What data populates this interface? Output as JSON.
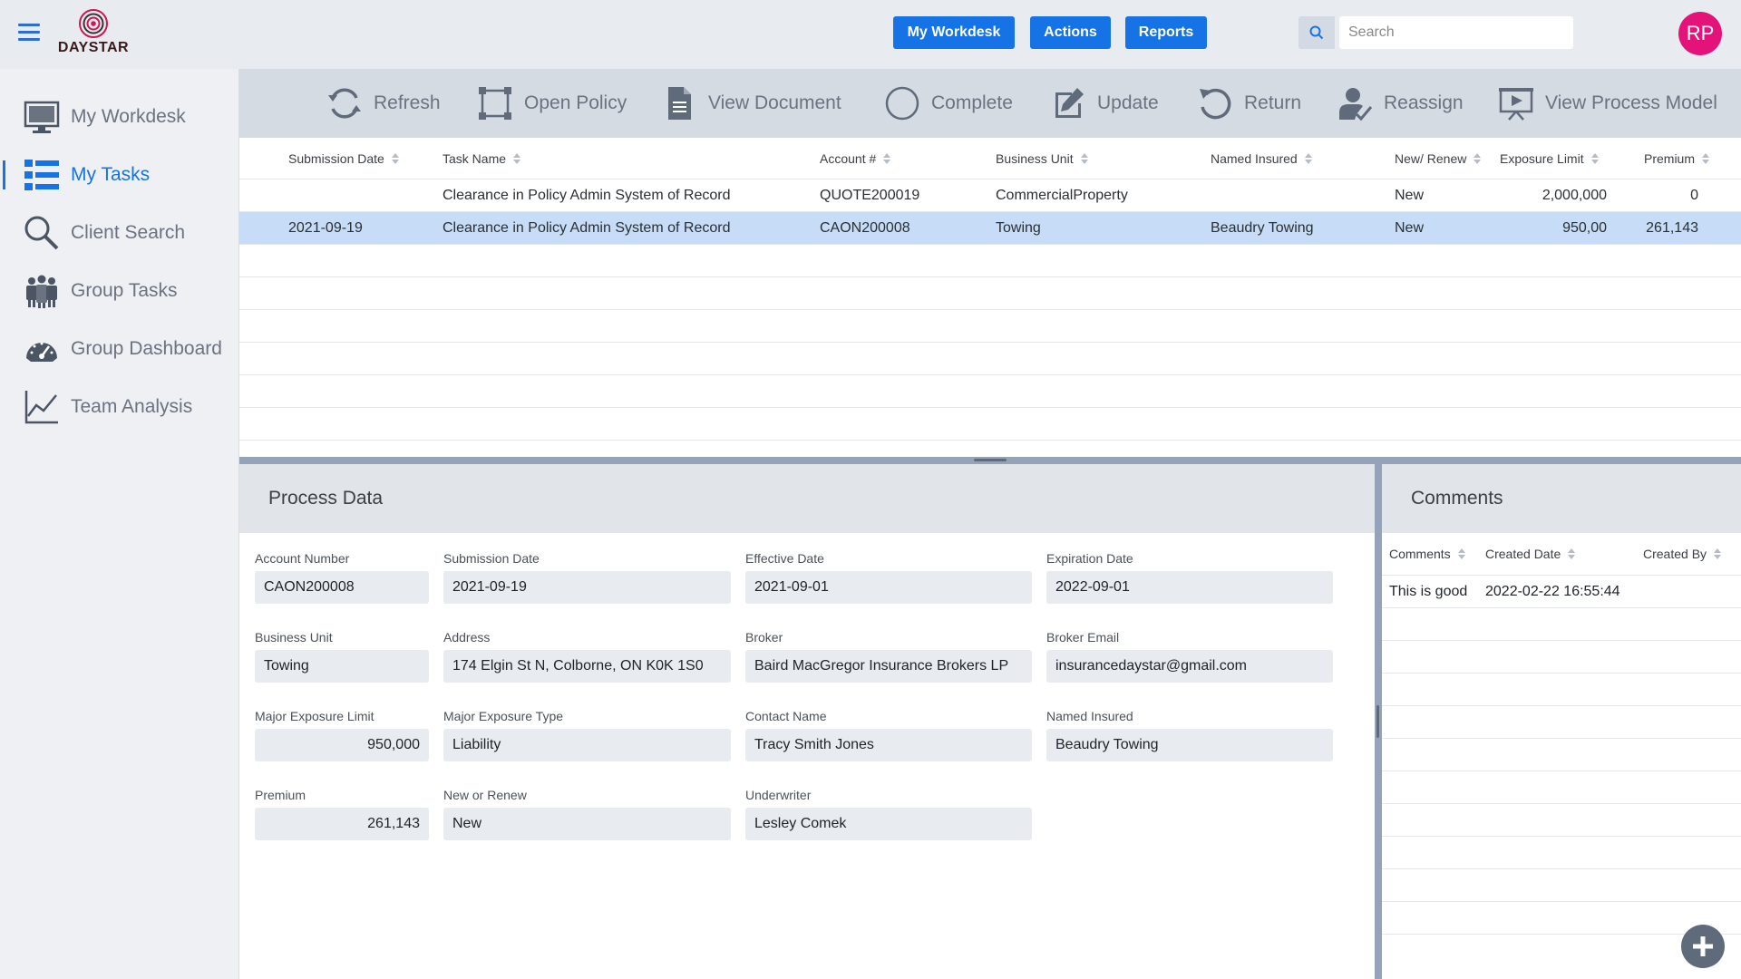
{
  "header": {
    "logo_text": "DAYSTAR",
    "nav_buttons": [
      "My Workdesk",
      "Actions",
      "Reports"
    ],
    "search_placeholder": "Search",
    "avatar_initials": "RP",
    "colors": {
      "accent": "#1673e6",
      "avatar": "#e3137a"
    }
  },
  "sidebar": {
    "items": [
      {
        "label": "My Workdesk",
        "icon": "monitor-icon",
        "active": false
      },
      {
        "label": "My Tasks",
        "icon": "task-list-icon",
        "active": true
      },
      {
        "label": "Client Search",
        "icon": "magnifier-icon",
        "active": false
      },
      {
        "label": "Group Tasks",
        "icon": "people-icon",
        "active": false
      },
      {
        "label": "Group Dashboard",
        "icon": "gauge-icon",
        "active": false
      },
      {
        "label": "Team Analysis",
        "icon": "line-chart-icon",
        "active": false
      }
    ]
  },
  "toolbar": {
    "items": [
      {
        "label": "Refresh",
        "icon": "refresh-icon"
      },
      {
        "label": "Open Policy",
        "icon": "open-policy-icon"
      },
      {
        "label": "View Document",
        "icon": "document-icon"
      },
      {
        "label": "Complete",
        "icon": "circle-icon"
      },
      {
        "label": "Update",
        "icon": "edit-icon"
      },
      {
        "label": "Return",
        "icon": "return-icon"
      },
      {
        "label": "Reassign",
        "icon": "reassign-user-icon"
      },
      {
        "label": "View Process Model",
        "icon": "process-model-icon"
      }
    ]
  },
  "task_grid": {
    "columns": [
      "Submission Date",
      "Task Name",
      "Account #",
      "Business Unit",
      "Named Insured",
      "New/ Renew",
      "Exposure Limit",
      "Premium"
    ],
    "rows": [
      {
        "submission_date": "",
        "task_name": "Clearance in Policy Admin System of Record",
        "account": "QUOTE200019",
        "business_unit": "CommercialProperty",
        "named_insured": "",
        "new_renew": "New",
        "exposure_limit": "2,000,000",
        "premium": "0",
        "selected": false
      },
      {
        "submission_date": "2021-09-19",
        "task_name": "Clearance in Policy Admin System of Record",
        "account": "CAON200008",
        "business_unit": "Towing",
        "named_insured": "Beaudry Towing",
        "new_renew": "New",
        "exposure_limit": "950,00",
        "premium": "261,143",
        "selected": true
      }
    ]
  },
  "process_data": {
    "title": "Process Data",
    "fields": {
      "account_number": {
        "label": "Account Number",
        "value": "CAON200008"
      },
      "submission_date": {
        "label": "Submission Date",
        "value": "2021-09-19"
      },
      "effective_date": {
        "label": "Effective Date",
        "value": "2021-09-01"
      },
      "expiration_date": {
        "label": "Expiration Date",
        "value": "2022-09-01"
      },
      "business_unit": {
        "label": "Business Unit",
        "value": "Towing"
      },
      "address": {
        "label": "Address",
        "value": "174 Elgin St N, Colborne, ON K0K 1S0"
      },
      "broker": {
        "label": "Broker",
        "value": "Baird MacGregor Insurance Brokers LP"
      },
      "broker_email": {
        "label": "Broker Email",
        "value": "insurancedaystar@gmail.com"
      },
      "major_exposure_limit": {
        "label": "Major Exposure Limit",
        "value": "950,000"
      },
      "major_exposure_type": {
        "label": "Major Exposure Type",
        "value": "Liability"
      },
      "contact_name": {
        "label": "Contact Name",
        "value": "Tracy Smith Jones"
      },
      "named_insured": {
        "label": "Named Insured",
        "value": "Beaudry Towing"
      },
      "premium": {
        "label": "Premium",
        "value": "261,143"
      },
      "new_or_renew": {
        "label": "New or Renew",
        "value": "New"
      },
      "underwriter": {
        "label": "Underwriter",
        "value": "Lesley Comek"
      }
    }
  },
  "comments": {
    "title": "Comments",
    "columns": [
      "Comments",
      "Created Date",
      "Created By"
    ],
    "rows": [
      {
        "comment": "This is good",
        "created_date": "2022-02-22 16:55:44",
        "created_by": ""
      }
    ],
    "add_icon": "plus-icon"
  }
}
